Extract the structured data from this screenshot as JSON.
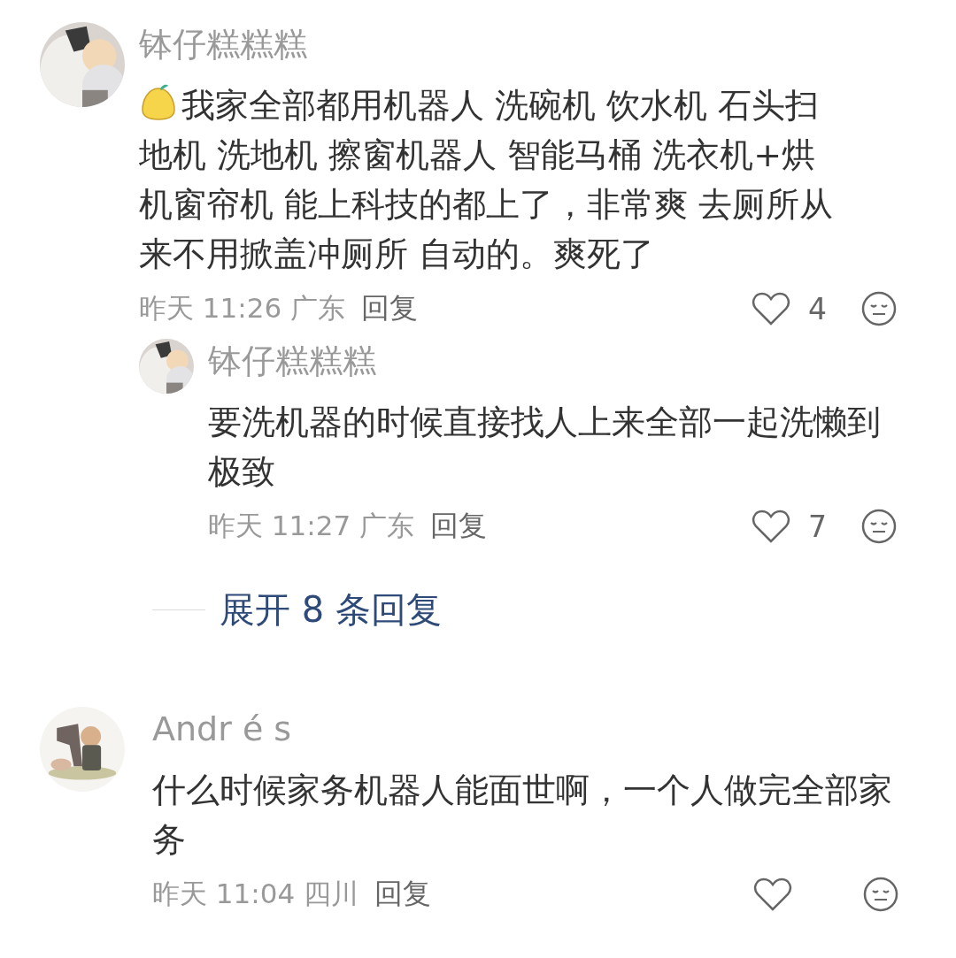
{
  "comments": [
    {
      "author": "钵仔糕糕糕",
      "emoji": true,
      "text": "我家全部都用机器人 洗碗机 饮水机 石头扫地机 洗地机 擦窗机器人 智能马桶 洗衣机+烘机窗帘机 能上科技的都上了，非常爽 去厕所从来不用掀盖冲厕所 自动的。爽死了",
      "time": "昨天 11:26 广东",
      "reply_label": "回复",
      "likes": "4",
      "replies": [
        {
          "author": "钵仔糕糕糕",
          "emoji": false,
          "text": "要洗机器的时候直接找人上来全部一起洗懒到极致",
          "time": "昨天 11:27 广东",
          "reply_label": "回复",
          "likes": "7"
        }
      ],
      "expand": "展开 8 条回复"
    },
    {
      "author": "Andr é s",
      "emoji": false,
      "text": "什么时候家务机器人能面世啊，一个人做完全部家务",
      "time": "昨天 11:04 四川",
      "reply_label": "回复"
    }
  ]
}
